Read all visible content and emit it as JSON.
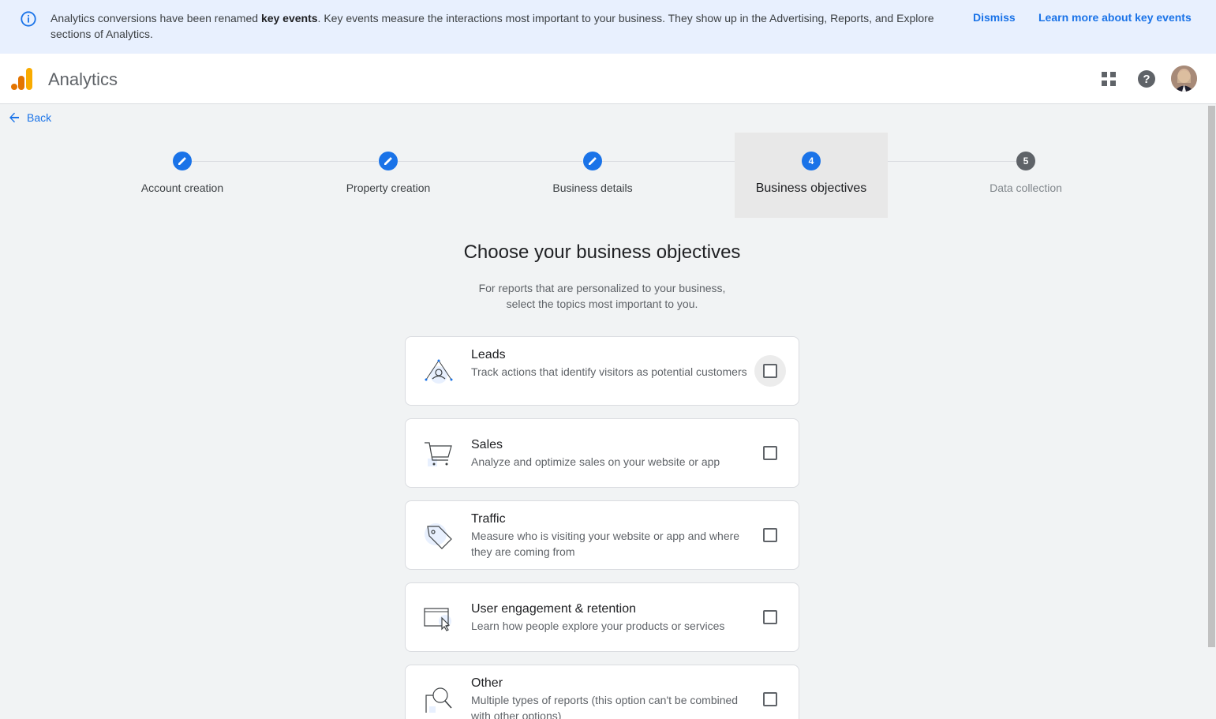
{
  "banner": {
    "text_before": "Analytics conversions have been renamed ",
    "text_bold": "key events",
    "text_after": ". Key events measure the interactions most important to your business. They show up in the Advertising, Reports, and Explore sections of Analytics.",
    "dismiss": "Dismiss",
    "learn_more": "Learn more about key events",
    "icon": "info-icon"
  },
  "header": {
    "app_name": "Analytics",
    "icons": [
      "apps-grid-icon",
      "help-icon"
    ]
  },
  "back_label": "Back",
  "steps": [
    {
      "label": "Account creation",
      "state": "completed",
      "icon": "pencil-icon"
    },
    {
      "label": "Property creation",
      "state": "completed",
      "icon": "pencil-icon"
    },
    {
      "label": "Business details",
      "state": "completed",
      "icon": "pencil-icon"
    },
    {
      "label": "Business objectives",
      "state": "active",
      "number": "4"
    },
    {
      "label": "Data collection",
      "state": "upcoming",
      "number": "5"
    }
  ],
  "main": {
    "title": "Choose your business objectives",
    "subtitle_line1": "For reports that are personalized to your business,",
    "subtitle_line2": "select the topics most important to you."
  },
  "objectives": [
    {
      "title": "Leads",
      "description": "Track actions that identify visitors as potential customers",
      "icon": "leads-icon",
      "checked": false
    },
    {
      "title": "Sales",
      "description": "Analyze and optimize sales on your website or app",
      "icon": "shopping-cart-icon",
      "checked": false
    },
    {
      "title": "Traffic",
      "description": "Measure who is visiting your website or app and where they are coming from",
      "icon": "tag-icon",
      "checked": false
    },
    {
      "title": "User engagement & retention",
      "description": "Learn how people explore your products or services",
      "icon": "browser-cursor-icon",
      "checked": false
    },
    {
      "title": "Other",
      "description": "Multiple types of reports (this option can't be combined with other options)",
      "icon": "magnifier-icon",
      "checked": false
    }
  ],
  "colors": {
    "accent": "#1a73e8",
    "banner_bg": "#e8f0fe",
    "step_disabled": "#5f6368",
    "logo_orange": "#f9ab00",
    "logo_dark_orange": "#e37400"
  }
}
